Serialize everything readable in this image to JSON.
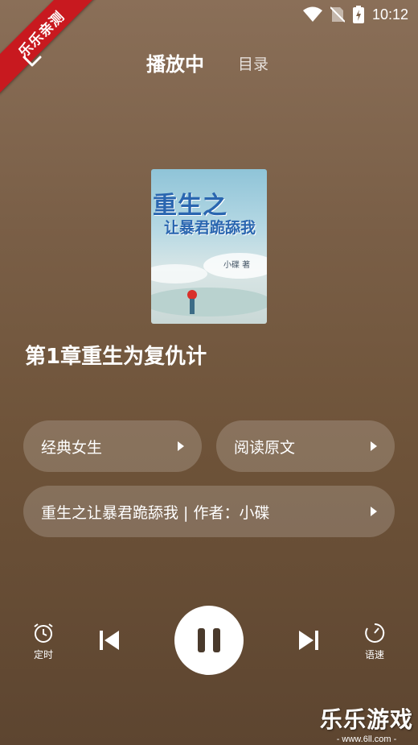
{
  "watermark": {
    "ribbon": "乐乐亲测",
    "logo": "乐乐游戏",
    "url": "- www.6ll.com -"
  },
  "status": {
    "time": "10:12"
  },
  "header": {
    "active_tab": "播放中",
    "tab": "目录"
  },
  "book": {
    "cover_title_1": "重生之",
    "cover_title_2": "让暴君跪舔我",
    "cover_author": "小碟 著",
    "chapter": "第1章重生为复仇计"
  },
  "chips": {
    "category": "经典女生",
    "read": "阅读原文",
    "info": "重生之让暴君跪舔我 | 作者：小碟"
  },
  "controls": {
    "timer": "定时",
    "speed": "语速",
    "state": "playing"
  },
  "colors": {
    "accent": "#ffffff",
    "ribbon": "#c8191f"
  }
}
